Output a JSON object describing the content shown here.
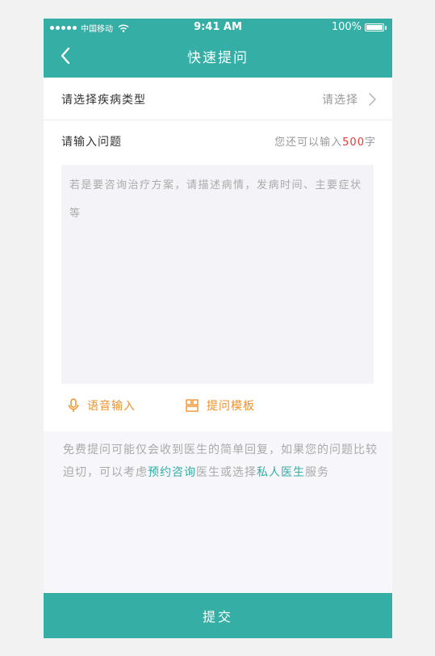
{
  "status_bar": {
    "carrier": "中国移动",
    "time": "9:41 AM",
    "battery": "100%",
    "battery_level": 1.0
  },
  "nav": {
    "title": "快速提问"
  },
  "form": {
    "disease_type_label": "请选择疾病类型",
    "disease_type_value": "请选择",
    "question_label": "请输入问题",
    "remaining_prefix": "您还可以输入",
    "remaining_count": "500",
    "remaining_suffix": "字",
    "question_placeholder": "若是要咨询治疗方案，请描述病情，发病时间、主要症状等"
  },
  "tools": {
    "voice_input": "语音输入",
    "question_template": "提问模板"
  },
  "notice": {
    "part1": "免费提问可能仅会收到医生的简单回复，如果您的问题比较迫切，可以考虑",
    "link1": "预约咨询",
    "part2": "医生或选择",
    "link2": "私人医生",
    "part3": "服务"
  },
  "submit_label": "提交",
  "colors": {
    "brand": "#35aea5",
    "accent": "#f0922b",
    "highlight_number": "#e53935"
  },
  "icons": [
    "back-arrow-icon",
    "chevron-right-icon",
    "microphone-icon",
    "template-icon",
    "wifi-icon",
    "battery-icon"
  ]
}
